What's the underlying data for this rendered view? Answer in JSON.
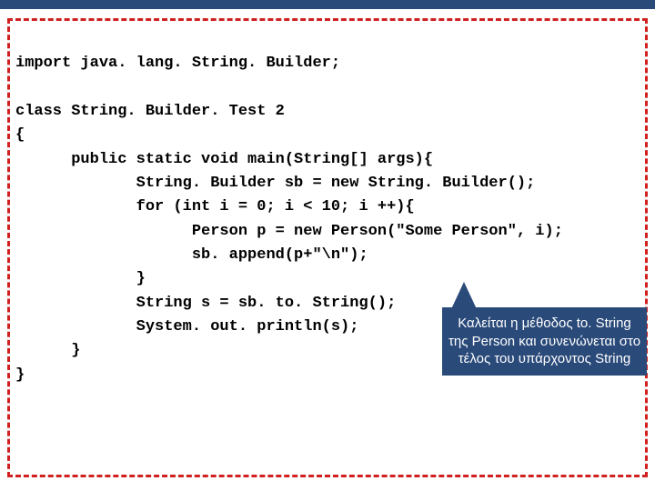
{
  "code": {
    "l1": "import java. lang. String. Builder;",
    "l2": "",
    "l3": "class String. Builder. Test 2",
    "l4": "{",
    "l5": "      public static void main(String[] args){",
    "l6": "             String. Builder sb = new String. Builder();",
    "l7": "             for (int i = 0; i < 10; i ++){",
    "l8": "                   Person p = new Person(\"Some Person\", i);",
    "l9": "                   sb. append(p+\"\\n\");",
    "l10": "             }",
    "l11": "             String s = sb. to. String();",
    "l12": "             System. out. println(s);",
    "l13": "      }",
    "l14": "}"
  },
  "callout": {
    "text": "Καλείται η μέθοδος to. String της Person και συνενώνεται στο τέλος του υπάρχοντος String"
  }
}
